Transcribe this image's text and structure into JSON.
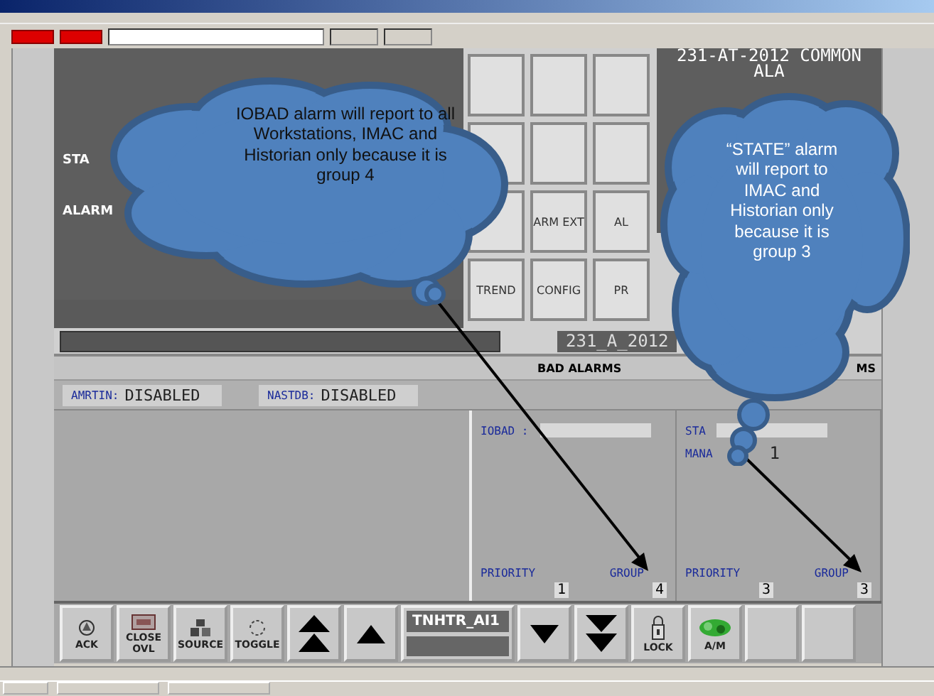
{
  "grid_buttons": [
    {
      "kind": "blank"
    },
    {
      "kind": "blank"
    },
    {
      "kind": "blank"
    },
    {
      "kind": "blank"
    },
    {
      "kind": "blank"
    },
    {
      "kind": "blank"
    },
    {
      "kind": "blank"
    },
    {
      "kind": "label",
      "label": "ARM EXT"
    },
    {
      "kind": "label",
      "label": "AL"
    },
    {
      "kind": "label",
      "label": "TREND"
    },
    {
      "kind": "label",
      "label": "CONFIG"
    },
    {
      "kind": "label",
      "label": "PR"
    }
  ],
  "left_labels": [
    "STA",
    "ALARM"
  ],
  "tag_panel": {
    "title": "231-AT-2012 COMMON",
    "subtitle": "ALA"
  },
  "tag_name": "231_A_2012",
  "section_header": {
    "title": "BAD ALARMS",
    "right": "MS"
  },
  "status_fields": [
    {
      "label": "AMRTIN:",
      "value": "DISABLED"
    },
    {
      "label": "NASTDB:",
      "value": "DISABLED"
    }
  ],
  "alarm_panels": [
    {
      "name": "IOBAD :",
      "priority_label": "PRIORITY",
      "group_label": "GROUP",
      "priority": "1",
      "group": "4"
    },
    {
      "name": "STA",
      "extra_label": "MANA",
      "extra_value": "1",
      "priority_label": "PRIORITY",
      "group_label": "GROUP",
      "priority": "3",
      "group": "3"
    }
  ],
  "toolbar": [
    {
      "kind": "icon",
      "label": "ACK"
    },
    {
      "kind": "icon",
      "label": "CLOSE OVL"
    },
    {
      "kind": "icon",
      "label": "SOURCE"
    },
    {
      "kind": "icon",
      "label": "TOGGLE"
    },
    {
      "kind": "arrow"
    },
    {
      "kind": "arrow"
    },
    {
      "kind": "tag",
      "label": "TNHTR_AI1"
    },
    {
      "kind": "arrow"
    },
    {
      "kind": "arrow"
    },
    {
      "kind": "icon",
      "label": "LOCK"
    },
    {
      "kind": "icon",
      "label": "A/M"
    },
    {
      "kind": "blank"
    },
    {
      "kind": "blank"
    }
  ],
  "annotations": [
    {
      "text": "IOBAD alarm will report to all Workstations, IMAC and Historian only because it is group 4"
    },
    {
      "text": "“STATE” alarm will report to IMAC and Historian only because it is group 3"
    }
  ]
}
